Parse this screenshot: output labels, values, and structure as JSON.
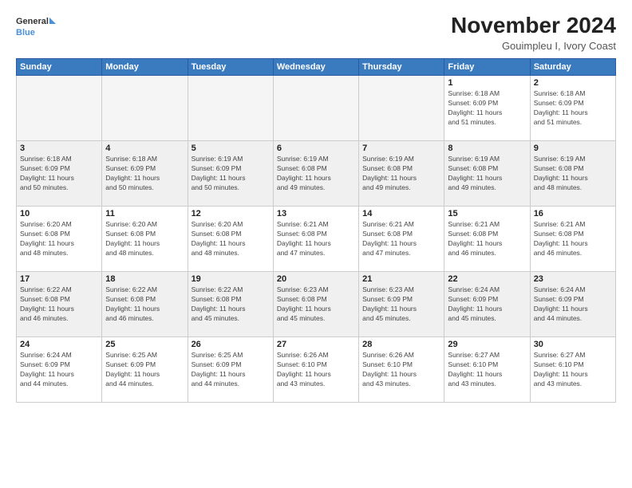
{
  "header": {
    "logo_line1": "General",
    "logo_line2": "Blue",
    "month_title": "November 2024",
    "location": "Gouimpleu I, Ivory Coast"
  },
  "weekdays": [
    "Sunday",
    "Monday",
    "Tuesday",
    "Wednesday",
    "Thursday",
    "Friday",
    "Saturday"
  ],
  "weeks": [
    [
      {
        "day": "",
        "info": ""
      },
      {
        "day": "",
        "info": ""
      },
      {
        "day": "",
        "info": ""
      },
      {
        "day": "",
        "info": ""
      },
      {
        "day": "",
        "info": ""
      },
      {
        "day": "1",
        "info": "Sunrise: 6:18 AM\nSunset: 6:09 PM\nDaylight: 11 hours\nand 51 minutes."
      },
      {
        "day": "2",
        "info": "Sunrise: 6:18 AM\nSunset: 6:09 PM\nDaylight: 11 hours\nand 51 minutes."
      }
    ],
    [
      {
        "day": "3",
        "info": "Sunrise: 6:18 AM\nSunset: 6:09 PM\nDaylight: 11 hours\nand 50 minutes."
      },
      {
        "day": "4",
        "info": "Sunrise: 6:18 AM\nSunset: 6:09 PM\nDaylight: 11 hours\nand 50 minutes."
      },
      {
        "day": "5",
        "info": "Sunrise: 6:19 AM\nSunset: 6:09 PM\nDaylight: 11 hours\nand 50 minutes."
      },
      {
        "day": "6",
        "info": "Sunrise: 6:19 AM\nSunset: 6:08 PM\nDaylight: 11 hours\nand 49 minutes."
      },
      {
        "day": "7",
        "info": "Sunrise: 6:19 AM\nSunset: 6:08 PM\nDaylight: 11 hours\nand 49 minutes."
      },
      {
        "day": "8",
        "info": "Sunrise: 6:19 AM\nSunset: 6:08 PM\nDaylight: 11 hours\nand 49 minutes."
      },
      {
        "day": "9",
        "info": "Sunrise: 6:19 AM\nSunset: 6:08 PM\nDaylight: 11 hours\nand 48 minutes."
      }
    ],
    [
      {
        "day": "10",
        "info": "Sunrise: 6:20 AM\nSunset: 6:08 PM\nDaylight: 11 hours\nand 48 minutes."
      },
      {
        "day": "11",
        "info": "Sunrise: 6:20 AM\nSunset: 6:08 PM\nDaylight: 11 hours\nand 48 minutes."
      },
      {
        "day": "12",
        "info": "Sunrise: 6:20 AM\nSunset: 6:08 PM\nDaylight: 11 hours\nand 48 minutes."
      },
      {
        "day": "13",
        "info": "Sunrise: 6:21 AM\nSunset: 6:08 PM\nDaylight: 11 hours\nand 47 minutes."
      },
      {
        "day": "14",
        "info": "Sunrise: 6:21 AM\nSunset: 6:08 PM\nDaylight: 11 hours\nand 47 minutes."
      },
      {
        "day": "15",
        "info": "Sunrise: 6:21 AM\nSunset: 6:08 PM\nDaylight: 11 hours\nand 46 minutes."
      },
      {
        "day": "16",
        "info": "Sunrise: 6:21 AM\nSunset: 6:08 PM\nDaylight: 11 hours\nand 46 minutes."
      }
    ],
    [
      {
        "day": "17",
        "info": "Sunrise: 6:22 AM\nSunset: 6:08 PM\nDaylight: 11 hours\nand 46 minutes."
      },
      {
        "day": "18",
        "info": "Sunrise: 6:22 AM\nSunset: 6:08 PM\nDaylight: 11 hours\nand 46 minutes."
      },
      {
        "day": "19",
        "info": "Sunrise: 6:22 AM\nSunset: 6:08 PM\nDaylight: 11 hours\nand 45 minutes."
      },
      {
        "day": "20",
        "info": "Sunrise: 6:23 AM\nSunset: 6:08 PM\nDaylight: 11 hours\nand 45 minutes."
      },
      {
        "day": "21",
        "info": "Sunrise: 6:23 AM\nSunset: 6:09 PM\nDaylight: 11 hours\nand 45 minutes."
      },
      {
        "day": "22",
        "info": "Sunrise: 6:24 AM\nSunset: 6:09 PM\nDaylight: 11 hours\nand 45 minutes."
      },
      {
        "day": "23",
        "info": "Sunrise: 6:24 AM\nSunset: 6:09 PM\nDaylight: 11 hours\nand 44 minutes."
      }
    ],
    [
      {
        "day": "24",
        "info": "Sunrise: 6:24 AM\nSunset: 6:09 PM\nDaylight: 11 hours\nand 44 minutes."
      },
      {
        "day": "25",
        "info": "Sunrise: 6:25 AM\nSunset: 6:09 PM\nDaylight: 11 hours\nand 44 minutes."
      },
      {
        "day": "26",
        "info": "Sunrise: 6:25 AM\nSunset: 6:09 PM\nDaylight: 11 hours\nand 44 minutes."
      },
      {
        "day": "27",
        "info": "Sunrise: 6:26 AM\nSunset: 6:10 PM\nDaylight: 11 hours\nand 43 minutes."
      },
      {
        "day": "28",
        "info": "Sunrise: 6:26 AM\nSunset: 6:10 PM\nDaylight: 11 hours\nand 43 minutes."
      },
      {
        "day": "29",
        "info": "Sunrise: 6:27 AM\nSunset: 6:10 PM\nDaylight: 11 hours\nand 43 minutes."
      },
      {
        "day": "30",
        "info": "Sunrise: 6:27 AM\nSunset: 6:10 PM\nDaylight: 11 hours\nand 43 minutes."
      }
    ]
  ]
}
